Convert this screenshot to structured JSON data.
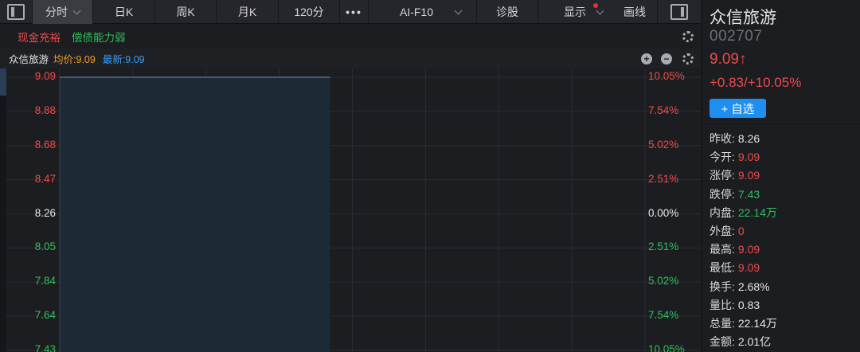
{
  "toolbar": {
    "tabs": [
      "分时",
      "日K",
      "周K",
      "月K",
      "120分"
    ],
    "more_icon": "•••",
    "ai": "AI-F10",
    "diagnose": "诊股",
    "display": "显示",
    "draw": "画线"
  },
  "tags": {
    "cash": "现金充裕",
    "debt": "偿债能力弱"
  },
  "chart_head": {
    "name": "众信旅游",
    "avg": "均价:9.09",
    "latest": "最新:9.09"
  },
  "chart_data": {
    "type": "line",
    "title": "",
    "y_left_ticks": [
      "9.09",
      "8.88",
      "8.68",
      "8.47",
      "8.26",
      "8.05",
      "7.84",
      "7.64",
      "7.43"
    ],
    "y_right_ticks": [
      "10.05%",
      "7.54%",
      "5.02%",
      "2.51%",
      "0.00%",
      "2.51%",
      "5.02%",
      "7.54%",
      "10.05%"
    ],
    "ylim": [
      7.43,
      9.09
    ],
    "prev_close": 8.26,
    "series": [
      {
        "name": "",
        "values": [
          9.09,
          9.09,
          9.09,
          9.09,
          9.09,
          9.09,
          9.09,
          9.09,
          9.09,
          9.09,
          9.09,
          9.09
        ]
      }
    ],
    "session_fraction": 0.462,
    "grid": true
  },
  "info": {
    "name": "众信旅游",
    "code": "002707",
    "price": "9.09↑",
    "change": "+0.83/+10.05%",
    "add_label": "+ 自选",
    "rows": [
      {
        "k": "昨收:",
        "v": "8.26",
        "c": "white"
      },
      {
        "k": "今开:",
        "v": "9.09",
        "c": "red"
      },
      {
        "k": "涨停:",
        "v": "9.09",
        "c": "red"
      },
      {
        "k": "跌停:",
        "v": "7.43",
        "c": "green"
      },
      {
        "k": "内盘:",
        "v": "22.14万",
        "c": "green"
      },
      {
        "k": "外盘:",
        "v": "0",
        "c": "red"
      },
      {
        "k": "最高:",
        "v": "9.09",
        "c": "red"
      },
      {
        "k": "最低:",
        "v": "9.09",
        "c": "red"
      },
      {
        "k": "换手:",
        "v": "2.68%",
        "c": "white"
      },
      {
        "k": "量比:",
        "v": "0.83",
        "c": "white"
      },
      {
        "k": "总量:",
        "v": "22.14万",
        "c": "white"
      },
      {
        "k": "金额:",
        "v": "2.01亿",
        "c": "white"
      }
    ]
  }
}
